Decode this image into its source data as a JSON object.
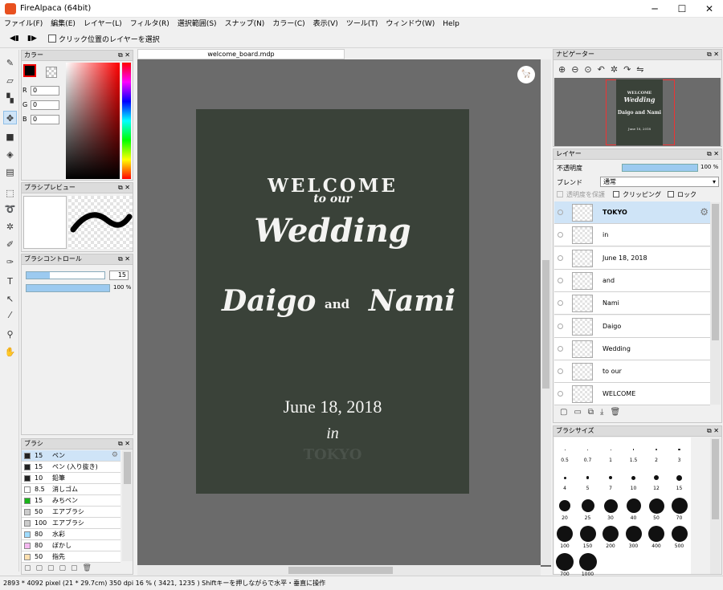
{
  "window": {
    "title": "FireAlpaca (64bit)"
  },
  "menu": [
    "ファイル(F)",
    "編集(E)",
    "レイヤー(L)",
    "フィルタ(R)",
    "選択範囲(S)",
    "スナップ(N)",
    "カラー(C)",
    "表示(V)",
    "ツール(T)",
    "ウィンドウ(W)",
    "Help"
  ],
  "toolbar": {
    "select_layer_label": "クリック位置のレイヤーを選択"
  },
  "color_panel": {
    "title": "カラー",
    "r_label": "R",
    "g_label": "G",
    "b_label": "B",
    "r": "0",
    "g": "0",
    "b": "0"
  },
  "brush_preview": {
    "title": "ブラシプレビュー"
  },
  "brush_control": {
    "title": "ブラシコントロール",
    "size": "15",
    "opacity": "100 %"
  },
  "brush_panel": {
    "title": "ブラシ",
    "items": [
      {
        "size": "15",
        "name": "ペン",
        "color": "#222222"
      },
      {
        "size": "15",
        "name": "ペン (入り抜き)",
        "color": "#222222"
      },
      {
        "size": "10",
        "name": "鉛筆",
        "color": "#222222"
      },
      {
        "size": "8.5",
        "name": "消しゴム",
        "color": "#ffffff"
      },
      {
        "size": "15",
        "name": "みちペン",
        "color": "#19b419"
      },
      {
        "size": "50",
        "name": "エアブラシ",
        "color": "#cccccc"
      },
      {
        "size": "100",
        "name": "エアブラシ",
        "color": "#cccccc"
      },
      {
        "size": "80",
        "name": "水彩",
        "color": "#9fdcff"
      },
      {
        "size": "80",
        "name": "ぼかし",
        "color": "#f4b8f0"
      },
      {
        "size": "50",
        "name": "指先",
        "color": "#ffe0b0"
      }
    ]
  },
  "document": {
    "tab": "welcome_board.mdp"
  },
  "board": {
    "line1": "WELCOME",
    "line2": "to our",
    "line3": "Wedding",
    "name1": "Daigo",
    "and": "and",
    "name2": "Nami",
    "date": "June 18, 2018",
    "in": "in",
    "faint": "TOKYO"
  },
  "navigator": {
    "title": "ナビゲーター",
    "mini_line1": "WELCOME",
    "mini_line2": "Wedding",
    "mini_line3": "Daigo and Nami",
    "mini_line4": "June 18, 2018"
  },
  "layers_panel": {
    "title": "レイヤー",
    "opacity_label": "不透明度",
    "opacity_value": "100 %",
    "blend_label": "ブレンド",
    "blend_value": "通常",
    "protect_label": "透明度を保護",
    "clipping_label": "クリッピング",
    "lock_label": "ロック",
    "layers": [
      "TOKYO",
      "in",
      "June 18, 2018",
      "and",
      "Nami",
      "Daigo",
      "Wedding",
      "to our",
      "WELCOME"
    ]
  },
  "brush_size_panel": {
    "title": "ブラシサイズ",
    "sizes": [
      "0.5",
      "0.7",
      "1",
      "1.5",
      "2",
      "3",
      "4",
      "5",
      "7",
      "10",
      "12",
      "15",
      "20",
      "25",
      "30",
      "40",
      "50",
      "70",
      "100",
      "150",
      "200",
      "300",
      "400",
      "500",
      "700",
      "1000"
    ]
  },
  "status": {
    "text": "2893 * 4092 pixel   (21 * 29.7cm)   350 dpi   16 %   ( 3421, 1235 )   Shiftキーを押しながらで水平・垂直に操作"
  }
}
